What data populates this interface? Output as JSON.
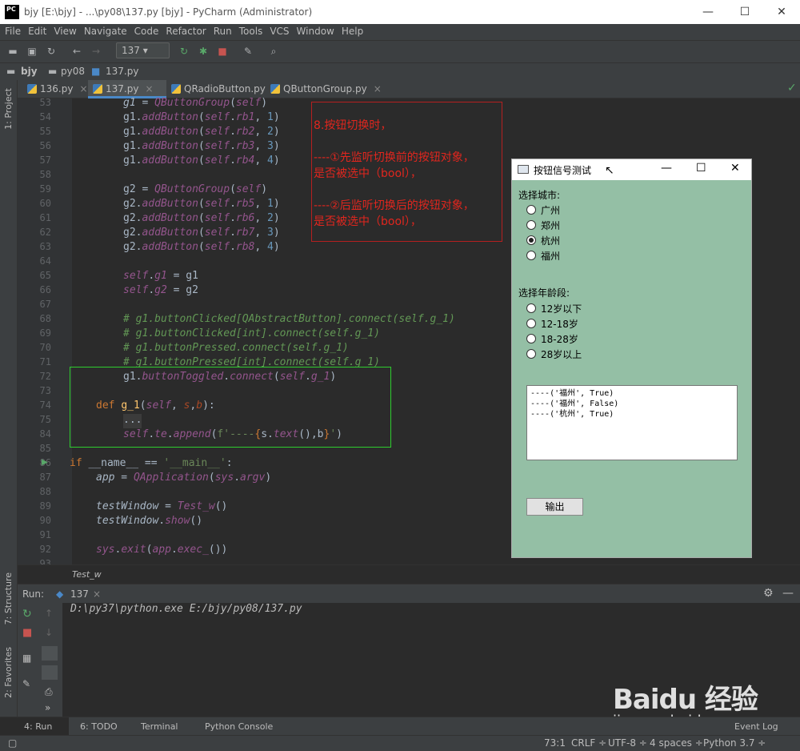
{
  "window": {
    "title": "bjy [E:\\bjy] - ...\\py08\\137.py [bjy] - PyCharm (Administrator)",
    "logo": "PC",
    "minimize": "—",
    "maximize": "☐",
    "close": "✕"
  },
  "menu": [
    "File",
    "Edit",
    "View",
    "Navigate",
    "Code",
    "Refactor",
    "Run",
    "Tools",
    "VCS",
    "Window",
    "Help"
  ],
  "toolbar": {
    "run_config": "137 ▾"
  },
  "navbar": {
    "project": "bjy",
    "folder": "py08",
    "file": "137.py"
  },
  "side": {
    "project": "1: Project",
    "structure": "7: Structure",
    "favorites": "2: Favorites"
  },
  "tabs": [
    {
      "label": "136.py"
    },
    {
      "label": "137.py"
    },
    {
      "label": "QRadioButton.py"
    },
    {
      "label": "QButtonGroup.py"
    }
  ],
  "lines": [
    "53",
    "54",
    "55",
    "56",
    "57",
    "58",
    "59",
    "60",
    "61",
    "62",
    "63",
    "64",
    "65",
    "66",
    "67",
    "68",
    "69",
    "70",
    "71",
    "72",
    "73",
    "74",
    "75",
    "84",
    "85",
    "86",
    "87",
    "88",
    "89",
    "90",
    "91",
    "92",
    "93"
  ],
  "annotation": {
    "l1": "8.按钮切换时，",
    "l2": "----①先监听切换前的按钮对象，",
    "l3": "是否被选中（bool），",
    "l4": "----②后监听切换后的按钮对象，",
    "l5": "是否被选中（bool），"
  },
  "qt": {
    "title": "按钮信号测试",
    "city_label": "选择城市:",
    "cities": [
      "广州",
      "郑州",
      "杭州",
      "福州"
    ],
    "age_label": "选择年龄段:",
    "ages": [
      "12岁以下",
      "12-18岁",
      "18-28岁",
      "28岁以上"
    ],
    "output": [
      "----('福州', True)",
      "----('福州', False)",
      "----('杭州', True)"
    ],
    "button": "输出"
  },
  "breadcrumb": "Test_w",
  "run": {
    "label": "Run:",
    "tab": "137",
    "command": "D:\\py37\\python.exe E:/bjy/py08/137.py"
  },
  "bottom_tabs": {
    "run": "4: Run",
    "todo": "6: TODO",
    "terminal": "Terminal",
    "console": "Python Console",
    "eventlog": "Event Log"
  },
  "status": {
    "pos": "73:1",
    "crlf": "CRLF ÷",
    "enc": "UTF-8 ÷",
    "indent": "4 spaces ÷",
    "py": "Python 3.7 ÷"
  },
  "watermark": {
    "brand": "Baidu 经验",
    "url": "jingyan.baidu.com"
  }
}
